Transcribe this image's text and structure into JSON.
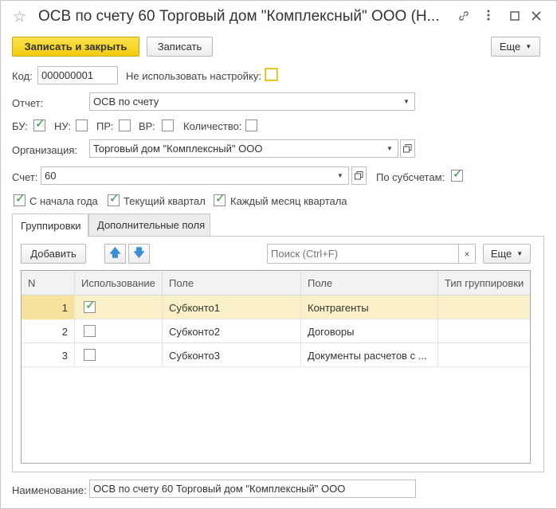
{
  "window": {
    "title": "ОСВ по счету 60 Торговый дом \"Комплексный\" ООО (Н...",
    "star_icon": "star-icon",
    "link_icon": "link-icon",
    "more_icon": "more-icon",
    "maximize_icon": "maximize-icon",
    "close_icon": "close-icon"
  },
  "toolbar": {
    "save_close_label": "Записать и закрыть",
    "save_label": "Записать",
    "more_label": "Еще"
  },
  "form": {
    "code_label": "Код:",
    "code_value": "000000001",
    "no_settings_label": "Не использовать настройку:",
    "no_settings_checked": false,
    "report_label": "Отчет:",
    "report_value": "ОСВ по счету",
    "bu_label": "БУ:",
    "bu_checked": true,
    "nu_label": "НУ:",
    "nu_checked": false,
    "pr_label": "ПР:",
    "pr_checked": false,
    "vr_label": "ВР:",
    "vr_checked": false,
    "qty_label": "Количество:",
    "qty_checked": false,
    "org_label": "Организация:",
    "org_value": "Торговый дом \"Комплексный\" ООО",
    "account_label": "Счет:",
    "account_value": "60",
    "subaccounts_label": "По субсчетам:",
    "subaccounts_checked": true,
    "from_year_start_label": "С начала года",
    "from_year_start_checked": true,
    "current_quarter_label": "Текущий квартал",
    "current_quarter_checked": true,
    "each_month_label": "Каждый месяц квартала",
    "each_month_checked": true,
    "name_label": "Наименование:",
    "name_value": "ОСВ по счету 60 Торговый дом \"Комплексный\" ООО"
  },
  "tabs": [
    {
      "label": "Группировки",
      "active": true
    },
    {
      "label": "Дополнительные поля",
      "active": false
    }
  ],
  "grouping_toolbar": {
    "add_label": "Добавить",
    "search_placeholder": "Поиск (Ctrl+F)",
    "more_label": "Еще"
  },
  "table": {
    "columns": [
      "N",
      "Использование",
      "Поле",
      "Поле",
      "Тип группировки"
    ],
    "rows": [
      {
        "n": "1",
        "used": true,
        "field": "Субконто1",
        "field2": "Контрагенты",
        "type": ""
      },
      {
        "n": "2",
        "used": false,
        "field": "Субконто2",
        "field2": "Договоры",
        "type": ""
      },
      {
        "n": "3",
        "used": false,
        "field": "Субконто3",
        "field2": "Документы расчетов с ...",
        "type": ""
      }
    ]
  },
  "colors": {
    "primary_button": "#f5d21e",
    "check_green": "#2e9a3e",
    "selected_row": "#faf0c8",
    "arrow_blue": "#3a8fd6"
  }
}
